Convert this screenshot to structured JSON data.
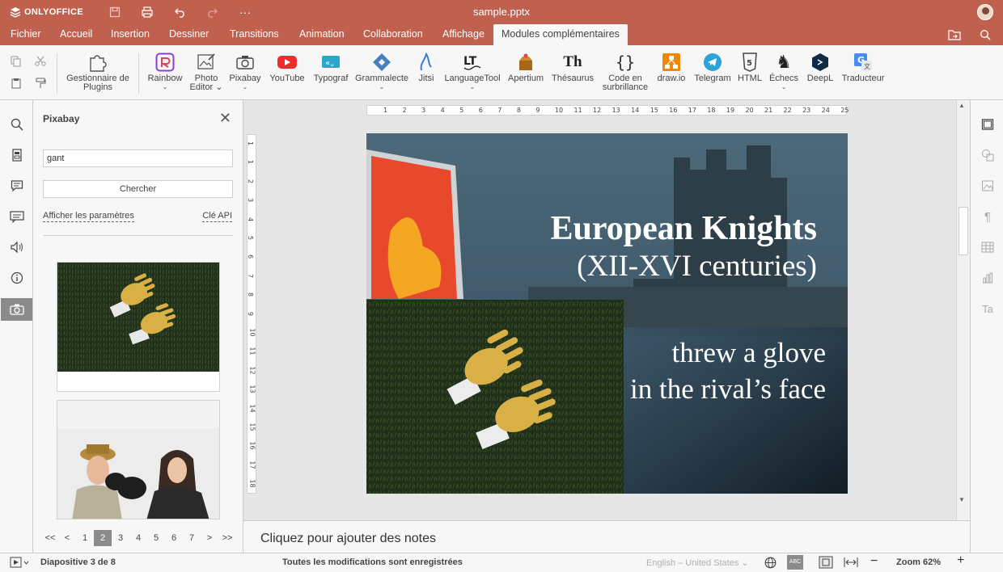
{
  "app": {
    "brand": "ONLYOFFICE",
    "doc_title": "sample.pptx",
    "accent": "#c0614f"
  },
  "tabs": [
    {
      "label": "Fichier"
    },
    {
      "label": "Accueil"
    },
    {
      "label": "Insertion"
    },
    {
      "label": "Dessiner"
    },
    {
      "label": "Transitions"
    },
    {
      "label": "Animation"
    },
    {
      "label": "Collaboration"
    },
    {
      "label": "Affichage"
    },
    {
      "label": "Modules complémentaires"
    }
  ],
  "toolbar": {
    "plugin_manager": {
      "l1": "Gestionnaire de",
      "l2": "Plugins"
    },
    "rainbow": "Rainbow",
    "photo_editor": {
      "l1": "Photo",
      "l2": "Editor"
    },
    "pixabay": "Pixabay",
    "youtube": "YouTube",
    "typograf": "Typograf",
    "grammalecte": "Grammalecte",
    "jitsi": "Jitsi",
    "languagetool": "LanguageTool",
    "apertium": "Apertium",
    "thesaurus": "Thésaurus",
    "code_highlight": {
      "l1": "Code en",
      "l2": "surbrillance"
    },
    "drawio": "draw.io",
    "telegram": "Telegram",
    "html": "HTML",
    "chess": "Échecs",
    "deepl": "DeepL",
    "translator": "Traducteur"
  },
  "plugin_panel": {
    "title": "Pixabay",
    "search_value": "gant",
    "search_button": "Chercher",
    "show_settings": "Afficher les paramètres",
    "api_key": "Clé API"
  },
  "pagination": [
    "<<",
    "<",
    "1",
    "2",
    "3",
    "4",
    "5",
    "6",
    "7",
    ">",
    ">>"
  ],
  "pagination_active": "2",
  "ruler": {
    "h": [
      "1",
      "2",
      "3",
      "4",
      "5",
      "6",
      "7",
      "8",
      "9",
      "10",
      "11",
      "12",
      "13",
      "14",
      "15",
      "16",
      "17",
      "18",
      "19",
      "20",
      "21",
      "22",
      "23",
      "24",
      "25"
    ],
    "v": [
      "1",
      "1",
      "2",
      "3",
      "4",
      "5",
      "6",
      "7",
      "8",
      "9",
      "10",
      "11",
      "12",
      "13",
      "14",
      "15",
      "16",
      "17",
      "18"
    ]
  },
  "slide": {
    "title": "European Knights",
    "subtitle": "(XII-XVI centuries)",
    "line1": "threw a glove",
    "line2": "in the rival’s face"
  },
  "notes_placeholder": "Cliquez pour ajouter des notes",
  "status": {
    "slide_counter": "Diapositive 3 de 8",
    "save_status": "Toutes les modifications sont enregistrées",
    "language": "English – United States",
    "zoom": "Zoom 62%"
  }
}
